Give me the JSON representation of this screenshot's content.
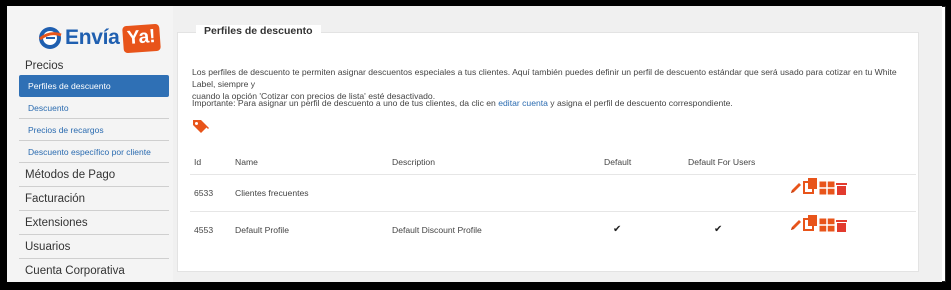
{
  "logo": {
    "word": "Envía",
    "badge": "Ya!"
  },
  "sidebar": {
    "items": [
      {
        "label": "Precios"
      },
      {
        "label": "Perfiles de descuento"
      },
      {
        "label": "Descuento"
      },
      {
        "label": "Precios de recargos"
      },
      {
        "label": "Descuento específico por cliente"
      },
      {
        "label": "Métodos de Pago"
      },
      {
        "label": "Facturación"
      },
      {
        "label": "Extensiones"
      },
      {
        "label": "Usuarios"
      },
      {
        "label": "Cuenta Corporativa"
      }
    ]
  },
  "panel": {
    "title": "Perfiles de descuento",
    "description_line1": "Los perfiles de descuento te permiten asignar descuentos especiales a tus clientes. Aquí también puedes definir un perfil de descuento estándar que será usado para cotizar en tu White Label, siempre y",
    "description_line2": "cuando la opción 'Cotizar con precios de lista' esté desactivado.",
    "important_prefix": "Importante: Para asignar un perfil de descuento a uno de tus clientes, da clic en ",
    "important_link": "editar cuenta",
    "important_suffix": " y asigna el perfil de descuento correspondiente."
  },
  "table": {
    "headers": {
      "id": "Id",
      "name": "Name",
      "description": "Description",
      "default": "Default",
      "default_users": "Default For Users"
    },
    "rows": [
      {
        "id": "6533",
        "name": "Clientes frecuentes",
        "description": "",
        "default": "",
        "default_users": ""
      },
      {
        "id": "4553",
        "name": "Default Profile",
        "description": "Default Discount Profile",
        "default": "✔",
        "default_users": "✔"
      }
    ]
  },
  "colors": {
    "accent": "#e8541a",
    "active": "#2f70b5",
    "link": "#2a6bb0",
    "delete": "#e23b2e"
  },
  "icons": [
    "tag-icon",
    "pencil-icon",
    "copy-icon",
    "grid-icon",
    "trash-icon"
  ]
}
